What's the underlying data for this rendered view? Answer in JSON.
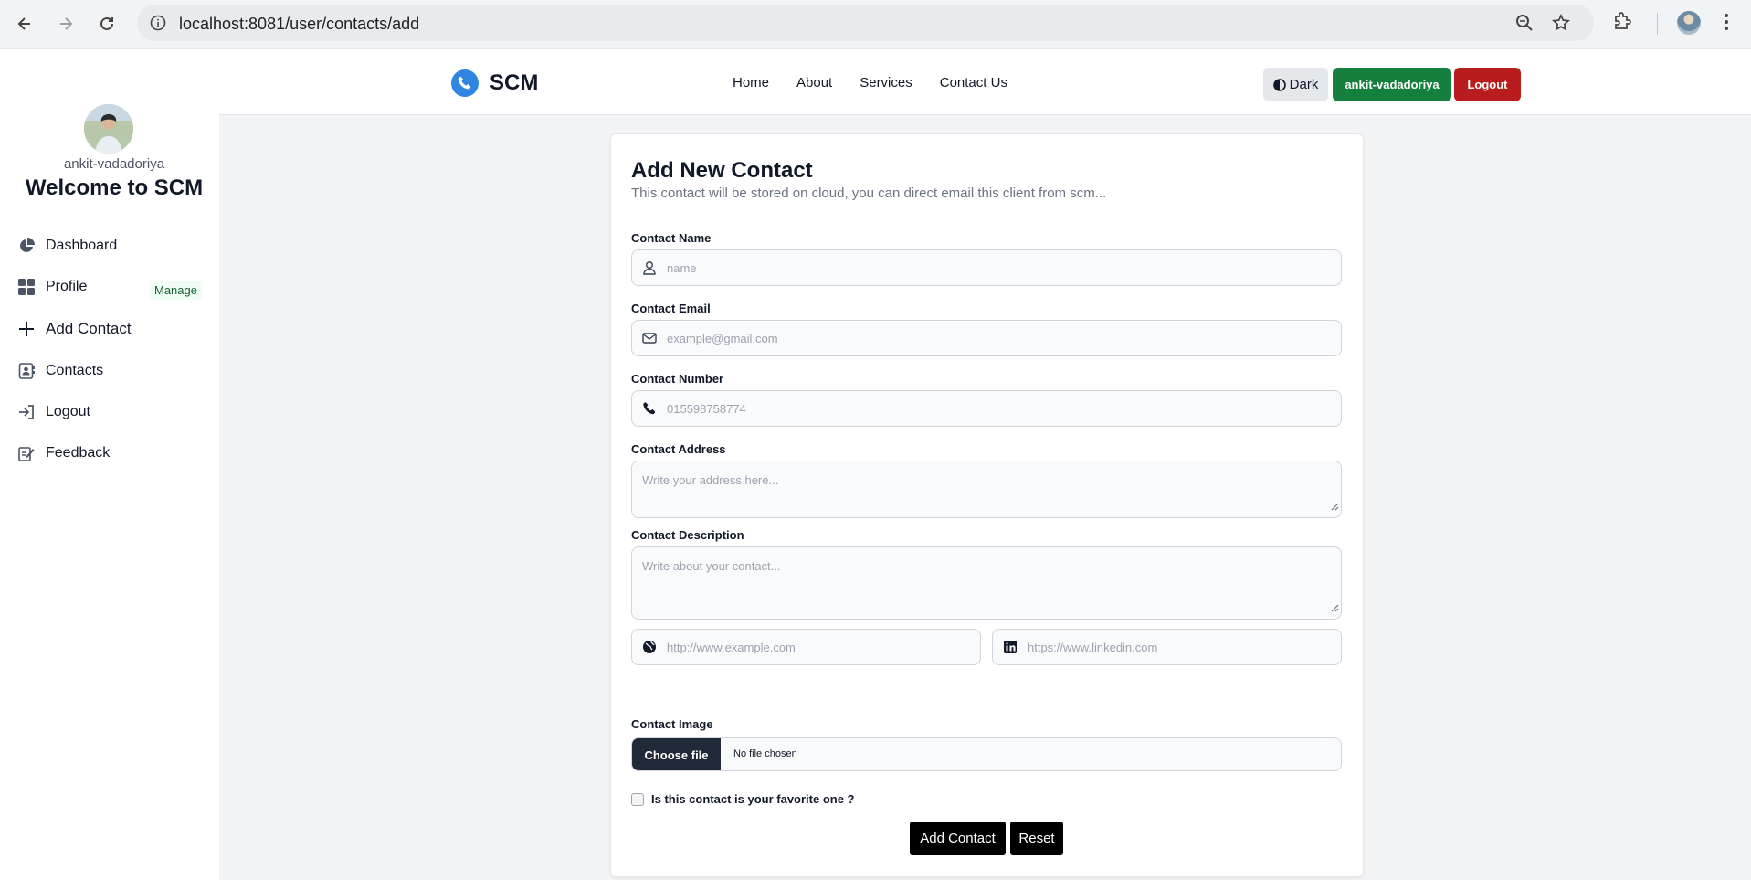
{
  "browser": {
    "url": "localhost:8081/user/contacts/add"
  },
  "sidebar": {
    "username": "ankit-vadadoriya",
    "welcome": "Welcome to SCM",
    "items": [
      {
        "label": "Dashboard",
        "icon": "pie-chart-icon"
      },
      {
        "label": "Profile",
        "icon": "grid-icon",
        "badge": "Manage"
      },
      {
        "label": "Add Contact",
        "icon": "plus-icon"
      },
      {
        "label": "Contacts",
        "icon": "contact-card-icon"
      },
      {
        "label": "Logout",
        "icon": "logout-icon"
      },
      {
        "label": "Feedback",
        "icon": "feedback-icon"
      }
    ]
  },
  "navbar": {
    "brand": "SCM",
    "links": [
      "Home",
      "About",
      "Services",
      "Contact Us"
    ],
    "theme_label": "Dark",
    "user_label": "ankit-vadadoriya",
    "logout_label": "Logout",
    "colors": {
      "user": "#15803d",
      "logout": "#b91c1c",
      "brand_icon": "#2f86e0"
    }
  },
  "form": {
    "title": "Add New Contact",
    "subtitle": "This contact will be stored on cloud, you can direct email this client from scm...",
    "name_label": "Contact Name",
    "name_placeholder": "name",
    "email_label": "Contact Email",
    "email_placeholder": "example@gmail.com",
    "number_label": "Contact Number",
    "number_placeholder": "015598758774",
    "address_label": "Contact Address",
    "address_placeholder": "Write your address here...",
    "description_label": "Contact Description",
    "description_placeholder": "Write about your contact...",
    "website_placeholder": "http://www.example.com",
    "linkedin_placeholder": "https://www.linkedin.com",
    "image_label": "Contact Image",
    "choose_file": "Choose file",
    "no_file": "No file chosen",
    "favorite_label": "Is this contact is your favorite one ?",
    "submit": "Add Contact",
    "reset": "Reset"
  }
}
